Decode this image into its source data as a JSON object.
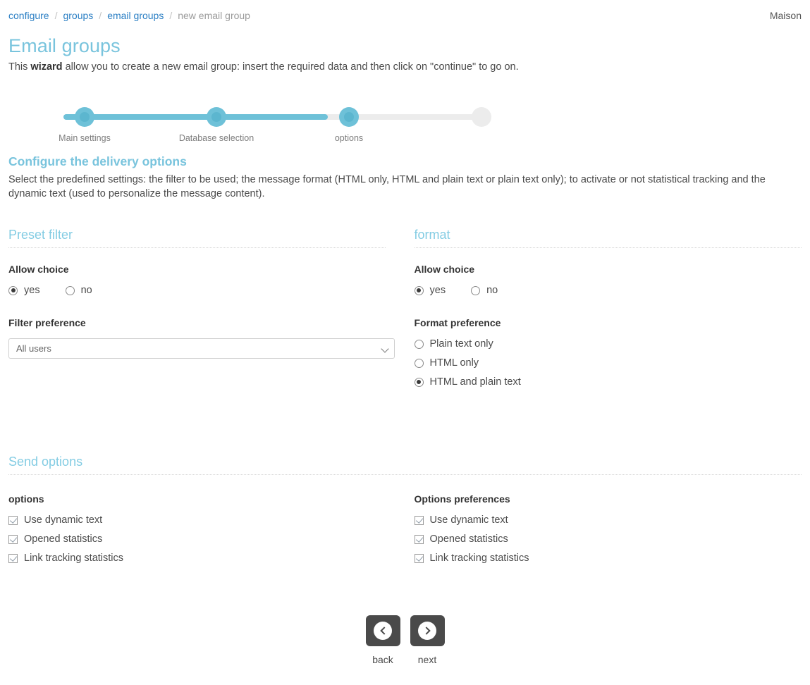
{
  "breadcrumb": {
    "items": [
      {
        "label": "configure",
        "current": false
      },
      {
        "label": "groups",
        "current": false
      },
      {
        "label": "email groups",
        "current": false
      },
      {
        "label": "new email group",
        "current": true
      }
    ],
    "separator": "/"
  },
  "header": {
    "user": "Maison",
    "title": "Email groups",
    "description_prefix": "This ",
    "description_bold": "wizard",
    "description_suffix": " allow you to create a new email group: insert the required data and then click on \"continue\" to go on."
  },
  "stepper": {
    "steps": [
      {
        "label": "Main settings",
        "active": true
      },
      {
        "label": "Database selection",
        "active": true
      },
      {
        "label": "options",
        "active": true
      },
      {
        "label": "",
        "active": false
      }
    ]
  },
  "intro": {
    "title": "Configure the delivery options",
    "description": "Select the predefined settings: the filter to be used; the message format (HTML only, HTML and plain text or plain text only); to activate or not statistical tracking and the dynamic text (used to personalize the message content)."
  },
  "preset_filter": {
    "panel_title": "Preset filter",
    "allow_choice_label": "Allow choice",
    "allow_choice_options": [
      {
        "label": "yes",
        "selected": true
      },
      {
        "label": "no",
        "selected": false
      }
    ],
    "filter_preference_label": "Filter preference",
    "filter_preference_value": "All users",
    "filter_preference_options": [
      "All users"
    ]
  },
  "format": {
    "panel_title": "format",
    "allow_choice_label": "Allow choice",
    "allow_choice_options": [
      {
        "label": "yes",
        "selected": true
      },
      {
        "label": "no",
        "selected": false
      }
    ],
    "format_preference_label": "Format preference",
    "format_preference_options": [
      {
        "label": "Plain text only",
        "selected": false
      },
      {
        "label": "HTML only",
        "selected": false
      },
      {
        "label": "HTML and plain text",
        "selected": true
      }
    ]
  },
  "send_options": {
    "panel_title": "Send options",
    "left_label": "options",
    "left_options": [
      {
        "label": "Use dynamic text",
        "checked": true
      },
      {
        "label": "Opened statistics",
        "checked": true
      },
      {
        "label": "Link tracking statistics",
        "checked": true
      }
    ],
    "right_label": "Options preferences",
    "right_options": [
      {
        "label": "Use dynamic text",
        "checked": true
      },
      {
        "label": "Opened statistics",
        "checked": true
      },
      {
        "label": "Link tracking statistics",
        "checked": true
      }
    ]
  },
  "nav": {
    "back_label": "back",
    "next_label": "next",
    "back_icon": "chevron-left-circle-icon",
    "next_icon": "chevron-right-circle-icon"
  },
  "colors": {
    "accent": "#79c4dd",
    "link": "#2b7fc4",
    "track_active": "#6ec1d8",
    "track_inactive": "#ececec",
    "button_bg": "#4a4a4a"
  }
}
